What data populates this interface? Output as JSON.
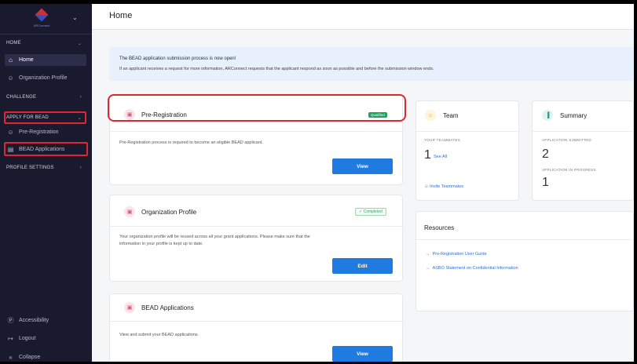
{
  "sidebar": {
    "brand": "ARConnect",
    "sections": {
      "home": "HOME",
      "challenge": "CHALLENGE",
      "apply": "APPLY FOR BEAD",
      "profile_settings": "PROFILE SETTINGS"
    },
    "items": {
      "home": "Home",
      "org_profile": "Organization Profile",
      "pre_registration": "Pre-Registration",
      "bead_applications": "BEAD Applications",
      "accessibility": "Accessibility",
      "logout": "Logout",
      "collapse": "Collapse"
    }
  },
  "header": {
    "title": "Home"
  },
  "banner": {
    "title": "The BEAD application submission process is now open!",
    "text": "If an applicant receives a request for more information, ARConnect requests that the applicant respond as soon as possible and before the submission window ends."
  },
  "cards": {
    "pre_registration": {
      "title": "Pre-Registration",
      "badge": "Qualified",
      "body": "Pre-Registration process is required to become an eligible BEAD applicant.",
      "button": "View"
    },
    "org_profile": {
      "title": "Organization Profile",
      "badge": "Completed",
      "body1": "Your organization profile will be reused across all your grant applications. Please make sure that the",
      "body2": "information in your profile is kept up to date.",
      "button": "Edit"
    },
    "bead_applications": {
      "title": "BEAD Applications",
      "body": "View and submit your BEAD applications.",
      "button": "View"
    }
  },
  "team": {
    "title": "Team",
    "label": "YOUR TEAMMATES",
    "count": "1",
    "see_all": "See All",
    "invite": "Invite Teammates"
  },
  "summary": {
    "title": "Summary",
    "submitted_label": "APPLICATION SUBMITTED",
    "submitted_count": "2",
    "in_progress_label": "APPLICATION IN PROGRESS",
    "in_progress_count": "1"
  },
  "resources": {
    "title": "Resources",
    "links": [
      "Pre-Registration User Guide",
      "ASBO Statement on Confidential Information"
    ]
  },
  "colors": {
    "sidebar_bg": "#1a1a2e",
    "accent": "#1f7be0",
    "highlight": "#e0262e",
    "qualified": "#21a05a"
  }
}
